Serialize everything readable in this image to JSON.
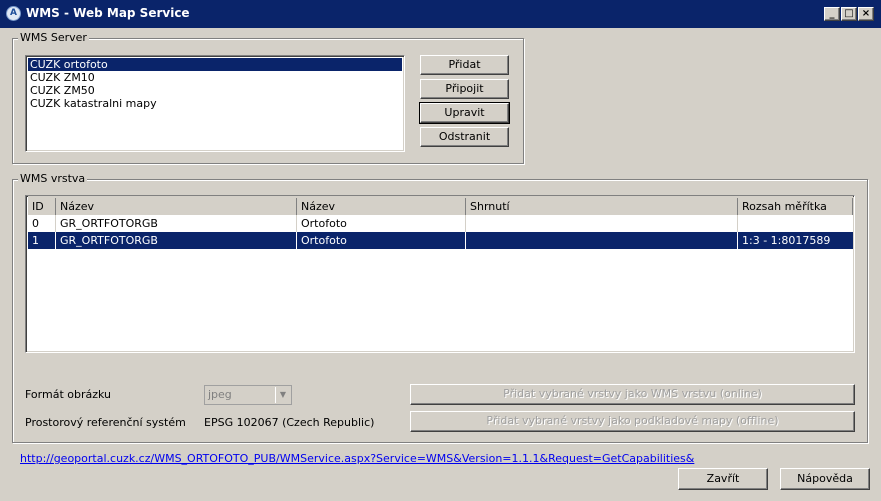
{
  "window": {
    "title": "WMS - Web Map Service",
    "icon_glyph": "A",
    "controls": {
      "minimize": "_",
      "maximize": "□",
      "close": "×"
    }
  },
  "server_group": {
    "legend": "WMS Server",
    "servers": [
      "CUZK ortofoto",
      "CUZK ZM10",
      "CUZK ZM50",
      "CUZK katastralni mapy"
    ],
    "selected_index": 0,
    "buttons": {
      "add": "Přidat",
      "connect": "Připojit",
      "edit": "Upravit",
      "remove": "Odstranit"
    }
  },
  "layer_group": {
    "legend": "WMS vrstva",
    "columns": [
      "ID",
      "Název",
      "Název",
      "Shrnutí",
      "Rozsah měřítka"
    ],
    "rows": [
      {
        "id": "0",
        "name": "GR_ORTFOTORGB",
        "title": "Ortofoto",
        "summary": "",
        "scale": ""
      },
      {
        "id": "1",
        "name": "GR_ORTFOTORGB",
        "title": "Ortofoto",
        "summary": "",
        "scale": "1:3 - 1:8017589"
      }
    ],
    "selected_row": 1,
    "format_label": "Formát obrázku",
    "format_value": "jpeg",
    "crs_label": "Prostorový referenční systém",
    "crs_value": "EPSG 102067 (Czech Republic)",
    "add_online_label": "Přidat vybrané vrstvy jako WMS vrstvu (online)",
    "add_offline_label": "Přidat vybrané vrstvy jako podkladové mapy (offline)"
  },
  "footer": {
    "url": "http://geoportal.cuzk.cz/WMS_ORTOFOTO_PUB/WMService.aspx?Service=WMS&Version=1.1.1&Request=GetCapabilities&",
    "close_label": "Zavřít",
    "help_label": "Nápověda"
  },
  "colors": {
    "titlebar": "#0a246a",
    "selection": "#0a246a",
    "face": "#d4d0c8",
    "link": "#0000ee"
  }
}
